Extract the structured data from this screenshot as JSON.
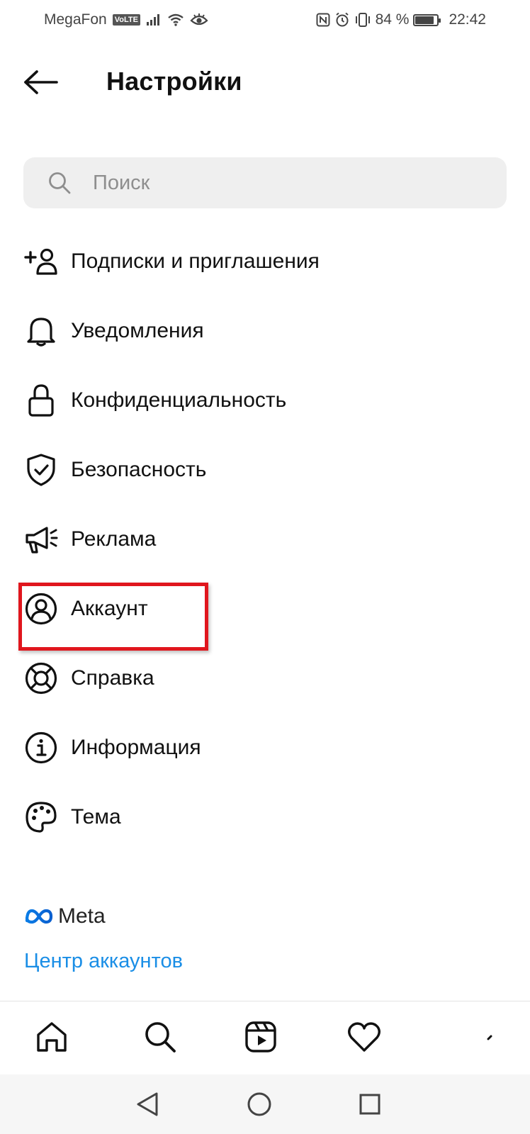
{
  "status_bar": {
    "carrier": "MegaFon",
    "volte": "VoLTE",
    "battery_percent": "84 %",
    "battery_level": 0.84,
    "time": "22:42"
  },
  "header": {
    "title": "Настройки",
    "back_icon": "arrow-left-icon"
  },
  "search": {
    "placeholder": "Поиск",
    "value": "",
    "icon": "search-icon"
  },
  "menu": {
    "items": [
      {
        "id": "follow-invite",
        "label": "Подписки и приглашения",
        "icon": "add-person-icon"
      },
      {
        "id": "notifications",
        "label": "Уведомления",
        "icon": "bell-icon"
      },
      {
        "id": "privacy",
        "label": "Конфиденциальность",
        "icon": "lock-icon"
      },
      {
        "id": "security",
        "label": "Безопасность",
        "icon": "shield-check-icon"
      },
      {
        "id": "ads",
        "label": "Реклама",
        "icon": "megaphone-icon"
      },
      {
        "id": "account",
        "label": "Аккаунт",
        "icon": "user-circle-icon"
      },
      {
        "id": "help",
        "label": "Справка",
        "icon": "lifebuoy-icon"
      },
      {
        "id": "info",
        "label": "Информация",
        "icon": "info-icon"
      },
      {
        "id": "theme",
        "label": "Тема",
        "icon": "palette-icon"
      }
    ],
    "highlighted_item": "account",
    "highlight_color": "#e0161d"
  },
  "meta": {
    "brand": "Meta",
    "brand_icon": "meta-infinity-icon",
    "accounts_center": "Центр аккаунтов",
    "link_color": "#1a8ee6"
  },
  "bottom_nav": {
    "items": [
      "home-icon",
      "search-icon",
      "reels-icon",
      "heart-icon"
    ]
  },
  "system_nav": {
    "items": [
      "back-triangle-icon",
      "home-circle-icon",
      "recents-square-icon"
    ]
  }
}
